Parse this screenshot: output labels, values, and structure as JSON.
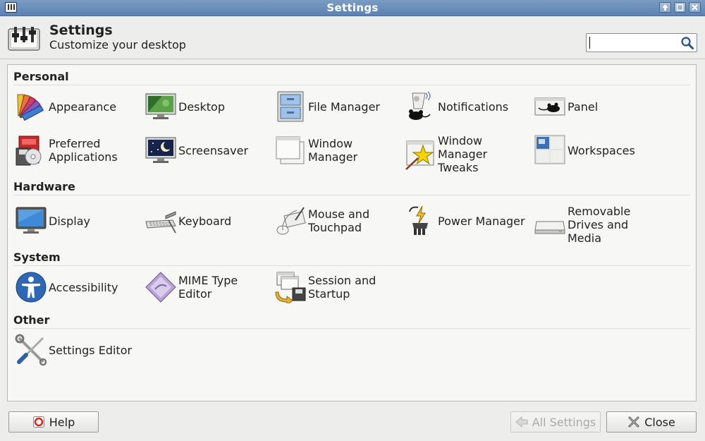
{
  "window": {
    "title": "Settings"
  },
  "header": {
    "title": "Settings",
    "subtitle": "Customize your desktop"
  },
  "search": {
    "value": "",
    "placeholder": ""
  },
  "sections": {
    "personal": {
      "title": "Personal",
      "items": [
        {
          "label": "Appearance",
          "icon": "appearance-icon"
        },
        {
          "label": "Desktop",
          "icon": "desktop-icon"
        },
        {
          "label": "File Manager",
          "icon": "file-manager-icon"
        },
        {
          "label": "Notifications",
          "icon": "notifications-icon"
        },
        {
          "label": "Panel",
          "icon": "panel-icon"
        },
        {
          "label": "Preferred\nApplications",
          "icon": "preferred-applications-icon"
        },
        {
          "label": "Screensaver",
          "icon": "screensaver-icon"
        },
        {
          "label": "Window\nManager",
          "icon": "window-manager-icon"
        },
        {
          "label": "Window\nManager\nTweaks",
          "icon": "window-manager-tweaks-icon"
        },
        {
          "label": "Workspaces",
          "icon": "workspaces-icon"
        }
      ]
    },
    "hardware": {
      "title": "Hardware",
      "items": [
        {
          "label": "Display",
          "icon": "display-icon"
        },
        {
          "label": "Keyboard",
          "icon": "keyboard-icon"
        },
        {
          "label": "Mouse and\nTouchpad",
          "icon": "mouse-icon"
        },
        {
          "label": "Power Manager",
          "icon": "power-manager-icon"
        },
        {
          "label": "Removable\nDrives and\nMedia",
          "icon": "removable-drives-icon"
        }
      ]
    },
    "system": {
      "title": "System",
      "items": [
        {
          "label": "Accessibility",
          "icon": "accessibility-icon"
        },
        {
          "label": "MIME Type\nEditor",
          "icon": "mime-type-icon"
        },
        {
          "label": "Session and\nStartup",
          "icon": "session-startup-icon"
        }
      ]
    },
    "other": {
      "title": "Other",
      "items": [
        {
          "label": "Settings Editor",
          "icon": "settings-editor-icon"
        }
      ]
    }
  },
  "buttons": {
    "help": "Help",
    "all_settings": "All Settings",
    "close": "Close"
  },
  "colors": {
    "titlebar": "#6a8fbd",
    "background": "#ededeb",
    "content_bg": "#f7f7f6",
    "disabled_text": "#a9a9a6"
  }
}
